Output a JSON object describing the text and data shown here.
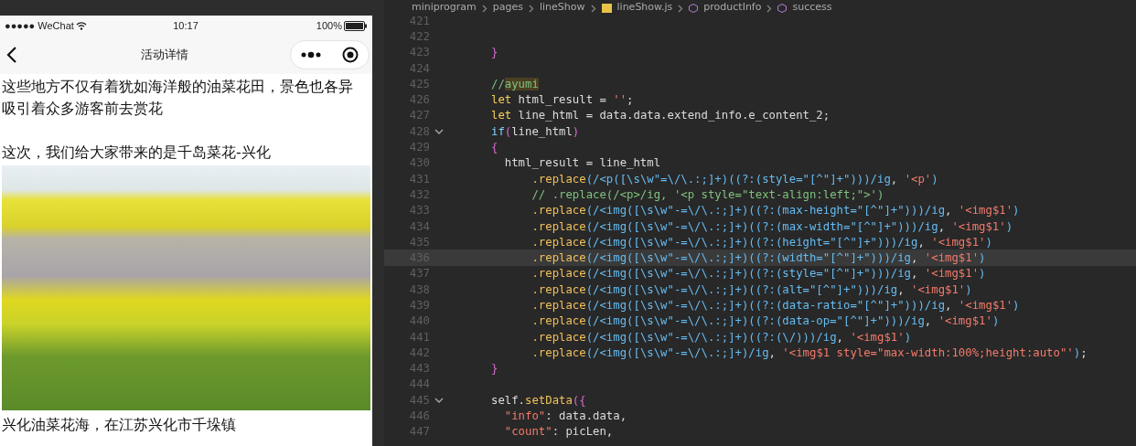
{
  "phone": {
    "status_bar": {
      "carrier": "●●●●● WeChat",
      "time": "10:17",
      "battery": "100%"
    },
    "nav_bar": {
      "title": "活动详情"
    },
    "content": [
      {
        "kind": "text",
        "text": "这些地方不仅有着犹如海洋般的油菜花田，景色也各异吸引着众多游客前去赏花"
      },
      {
        "kind": "blank"
      },
      {
        "kind": "text",
        "text": "这次，我们给大家带来的是千岛菜花-兴化"
      },
      {
        "kind": "photo"
      },
      {
        "kind": "text",
        "text": "兴化油菜花海，在江苏兴化市千垛镇"
      }
    ]
  },
  "editor": {
    "breadcrumbs": [
      {
        "text": "miniprogram",
        "kind": "folder"
      },
      {
        "text": "pages",
        "kind": "folder"
      },
      {
        "text": "lineShow",
        "kind": "folder"
      },
      {
        "text": "lineShow.js",
        "kind": "file"
      },
      {
        "text": "productInfo",
        "kind": "symbol"
      },
      {
        "text": "success",
        "kind": "symbol"
      }
    ],
    "lines": [
      {
        "number": "421",
        "current": false
      },
      {
        "number": "422",
        "current": false
      },
      {
        "number": "423",
        "current": false,
        "tokens": [
          {
            "kind": "br",
            "text": "}"
          }
        ]
      },
      {
        "number": "424",
        "current": false
      },
      {
        "number": "425",
        "current": false,
        "tokens": [
          {
            "kind": "cmt",
            "text": "//"
          },
          {
            "kind": "match",
            "text": "ayumi"
          }
        ]
      },
      {
        "number": "426",
        "current": false,
        "tokens": [
          {
            "kind": "kw",
            "text": "let"
          },
          {
            "kind": "txt",
            "text": " html_result = "
          },
          {
            "kind": "str",
            "text": "''"
          },
          {
            "kind": "txt",
            "text": ";"
          }
        ]
      },
      {
        "number": "427",
        "current": false,
        "tokens": [
          {
            "kind": "kw",
            "text": "let"
          },
          {
            "kind": "txt",
            "text": " line_html = data.data.extend_info.e_content_2;"
          }
        ]
      },
      {
        "number": "428",
        "current": false,
        "expanded": true,
        "tokens": [
          {
            "kind": "ctl",
            "text": "if"
          },
          {
            "kind": "br",
            "text": "("
          },
          {
            "kind": "txt",
            "text": "line_html"
          },
          {
            "kind": "br",
            "text": ")"
          }
        ]
      },
      {
        "number": "429",
        "current": false,
        "tokens": [
          {
            "kind": "br",
            "text": "{"
          }
        ]
      },
      {
        "number": "430",
        "current": false,
        "tokens": [
          {
            "kind": "txt",
            "text": "  html_result = line_html"
          }
        ]
      },
      {
        "number": "431",
        "current": false,
        "tokens": [
          {
            "kind": "fn",
            "text": "      .replace"
          },
          {
            "kind": "re",
            "text": "(/<p([\\s\\w\"=\\/\\.:;]+)((?:(style=\"[^\"]+\")))/ig"
          },
          {
            "kind": "txt",
            "text": ", "
          },
          {
            "kind": "str",
            "text": "'<p'"
          },
          {
            "kind": "re",
            "text": ")"
          }
        ]
      },
      {
        "number": "432",
        "current": false,
        "tokens": [
          {
            "kind": "cmt",
            "text": "      // .replace(/<p>/ig, '<p style=\"text-align:left;\">')"
          }
        ]
      },
      {
        "number": "433",
        "current": false,
        "tokens": [
          {
            "kind": "fn",
            "text": "      .replace"
          },
          {
            "kind": "re",
            "text": "(/<img([\\s\\w\"-=\\/\\.:;]+)((?:(max-height=\"[^\"]+\")))/ig"
          },
          {
            "kind": "txt",
            "text": ", "
          },
          {
            "kind": "str",
            "text": "'<img$1'"
          },
          {
            "kind": "re",
            "text": ")"
          }
        ]
      },
      {
        "number": "434",
        "current": false,
        "tokens": [
          {
            "kind": "fn",
            "text": "      .replace"
          },
          {
            "kind": "re",
            "text": "(/<img([\\s\\w\"-=\\/\\.:;]+)((?:(max-width=\"[^\"]+\")))/ig"
          },
          {
            "kind": "txt",
            "text": ", "
          },
          {
            "kind": "str",
            "text": "'<img$1'"
          },
          {
            "kind": "re",
            "text": ")"
          }
        ]
      },
      {
        "number": "435",
        "current": false,
        "tokens": [
          {
            "kind": "fn",
            "text": "      .replace"
          },
          {
            "kind": "re",
            "text": "(/<img([\\s\\w\"-=\\/\\.:;]+)((?:(height=\"[^\"]+\")))/ig"
          },
          {
            "kind": "txt",
            "text": ", "
          },
          {
            "kind": "str",
            "text": "'<img$1'"
          },
          {
            "kind": "re",
            "text": ")"
          }
        ]
      },
      {
        "number": "436",
        "current": true,
        "tokens": [
          {
            "kind": "fn",
            "text": "      .replace"
          },
          {
            "kind": "re",
            "text": "(/<img([\\s\\w\"-=\\/\\.:;]+)((?:(width=\"[^\"]+\")))/ig"
          },
          {
            "kind": "txt",
            "text": ", "
          },
          {
            "kind": "str",
            "text": "'<img$1'"
          },
          {
            "kind": "re",
            "text": ")"
          }
        ]
      },
      {
        "number": "437",
        "current": false,
        "tokens": [
          {
            "kind": "fn",
            "text": "      .replace"
          },
          {
            "kind": "re",
            "text": "(/<img([\\s\\w\"-=\\/\\.:;]+)((?:(style=\"[^\"]+\")))/ig"
          },
          {
            "kind": "txt",
            "text": ", "
          },
          {
            "kind": "str",
            "text": "'<img$1'"
          },
          {
            "kind": "re",
            "text": ")"
          }
        ]
      },
      {
        "number": "438",
        "current": false,
        "tokens": [
          {
            "kind": "fn",
            "text": "      .replace"
          },
          {
            "kind": "re",
            "text": "(/<img([\\s\\w\"-=\\/\\.:;]+)((?:(alt=\"[^\"]+\")))/ig"
          },
          {
            "kind": "txt",
            "text": ", "
          },
          {
            "kind": "str",
            "text": "'<img$1'"
          },
          {
            "kind": "re",
            "text": ")"
          }
        ]
      },
      {
        "number": "439",
        "current": false,
        "tokens": [
          {
            "kind": "fn",
            "text": "      .replace"
          },
          {
            "kind": "re",
            "text": "(/<img([\\s\\w\"-=\\/\\.:;]+)((?:(data-ratio=\"[^\"]+\")))/ig"
          },
          {
            "kind": "txt",
            "text": ", "
          },
          {
            "kind": "str",
            "text": "'<img$1'"
          },
          {
            "kind": "re",
            "text": ")"
          }
        ]
      },
      {
        "number": "440",
        "current": false,
        "tokens": [
          {
            "kind": "fn",
            "text": "      .replace"
          },
          {
            "kind": "re",
            "text": "(/<img([\\s\\w\"-=\\/\\.:;]+)((?:(data-op=\"[^\"]+\")))/ig"
          },
          {
            "kind": "txt",
            "text": ", "
          },
          {
            "kind": "str",
            "text": "'<img$1'"
          },
          {
            "kind": "re",
            "text": ")"
          }
        ]
      },
      {
        "number": "441",
        "current": false,
        "tokens": [
          {
            "kind": "fn",
            "text": "      .replace"
          },
          {
            "kind": "re",
            "text": "(/<img([\\s\\w\"-=\\/\\.:;]+)((?:(\\/)))/ig"
          },
          {
            "kind": "txt",
            "text": ", "
          },
          {
            "kind": "str",
            "text": "'<img$1'"
          },
          {
            "kind": "re",
            "text": ")"
          }
        ]
      },
      {
        "number": "442",
        "current": false,
        "tokens": [
          {
            "kind": "fn",
            "text": "      .replace"
          },
          {
            "kind": "re",
            "text": "(/<img([\\s\\w\"-=\\/\\.:;]+)/ig"
          },
          {
            "kind": "txt",
            "text": ", "
          },
          {
            "kind": "str",
            "text": "'<img$1 style=\"max-width:100%;height:auto\"'"
          },
          {
            "kind": "re",
            "text": ")"
          },
          {
            "kind": "txt",
            "text": ";"
          }
        ]
      },
      {
        "number": "443",
        "current": false,
        "tokens": [
          {
            "kind": "br",
            "text": "}"
          }
        ]
      },
      {
        "number": "444",
        "current": false
      },
      {
        "number": "445",
        "current": false,
        "expanded": true,
        "tokens": [
          {
            "kind": "txt",
            "text": "self."
          },
          {
            "kind": "fn",
            "text": "setData"
          },
          {
            "kind": "br",
            "text": "({"
          }
        ]
      },
      {
        "number": "446",
        "current": false,
        "tokens": [
          {
            "kind": "str",
            "text": "  \"info\""
          },
          {
            "kind": "txt",
            "text": ": data.data,"
          }
        ]
      },
      {
        "number": "447",
        "current": false,
        "tokens": [
          {
            "kind": "str",
            "text": "  \"count\""
          },
          {
            "kind": "txt",
            "text": ": picLen,"
          }
        ]
      }
    ]
  }
}
